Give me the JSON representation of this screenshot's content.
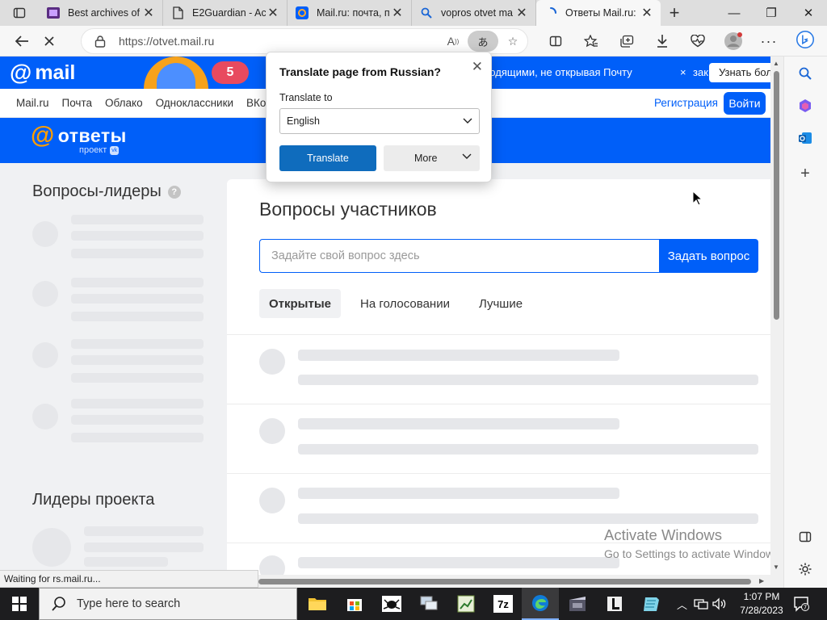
{
  "browser": {
    "tabs": [
      {
        "title": "Best archives of",
        "icon": "film-icon",
        "active": false
      },
      {
        "title": "E2Guardian - Ac",
        "icon": "document-icon",
        "active": false
      },
      {
        "title": "Mail.ru: почта, п",
        "icon": "mail-at-icon",
        "active": false
      },
      {
        "title": "vopros otvet ma",
        "icon": "search-icon",
        "active": false
      },
      {
        "title": "Ответы Mail.ru:",
        "icon": "loading-spinner-icon",
        "active": true
      }
    ],
    "url": "https://otvet.mail.ru",
    "translate_icon": "あ",
    "status_text": "Waiting for rs.mail.ru..."
  },
  "mail_header": {
    "logo_text": "mail",
    "promo_badge": "5",
    "promo_text": "ходящими, не открывая Почту",
    "promo_close": "×",
    "promo_tail": "зак",
    "promo_button": "Узнать бол"
  },
  "nav": {
    "links": [
      "Mail.ru",
      "Почта",
      "Облако",
      "Одноклассники",
      "ВКонт"
    ],
    "register": "Регистрация",
    "login": "Войти"
  },
  "otvety": {
    "brand": "ответы",
    "sub": "проект"
  },
  "sidebar": {
    "leaders_title": "Вопросы-лидеры",
    "leaders_help": "?",
    "project_leaders_title": "Лидеры проекта"
  },
  "main": {
    "title": "Вопросы участников",
    "ask_placeholder": "Задайте свой вопрос здесь",
    "ask_button": "Задать вопрос",
    "tabs": [
      {
        "label": "Открытые",
        "active": true
      },
      {
        "label": "На голосовании",
        "active": false
      },
      {
        "label": "Лучшие",
        "active": false
      }
    ]
  },
  "translate_popup": {
    "title": "Translate page from Russian?",
    "to_label": "Translate to",
    "language": "English",
    "translate_button": "Translate",
    "more_button": "More"
  },
  "watermark": {
    "line1": "Activate Windows",
    "line2": "Go to Settings to activate Windows."
  },
  "taskbar": {
    "search_placeholder": "Type here to search",
    "time": "1:07 PM",
    "date": "7/28/2023",
    "sevenzip_label": "7z"
  },
  "colors": {
    "mail_blue": "#005ff9",
    "otvety_orange": "#ff9e00",
    "edge_translate_blue": "#0f6cbd"
  }
}
